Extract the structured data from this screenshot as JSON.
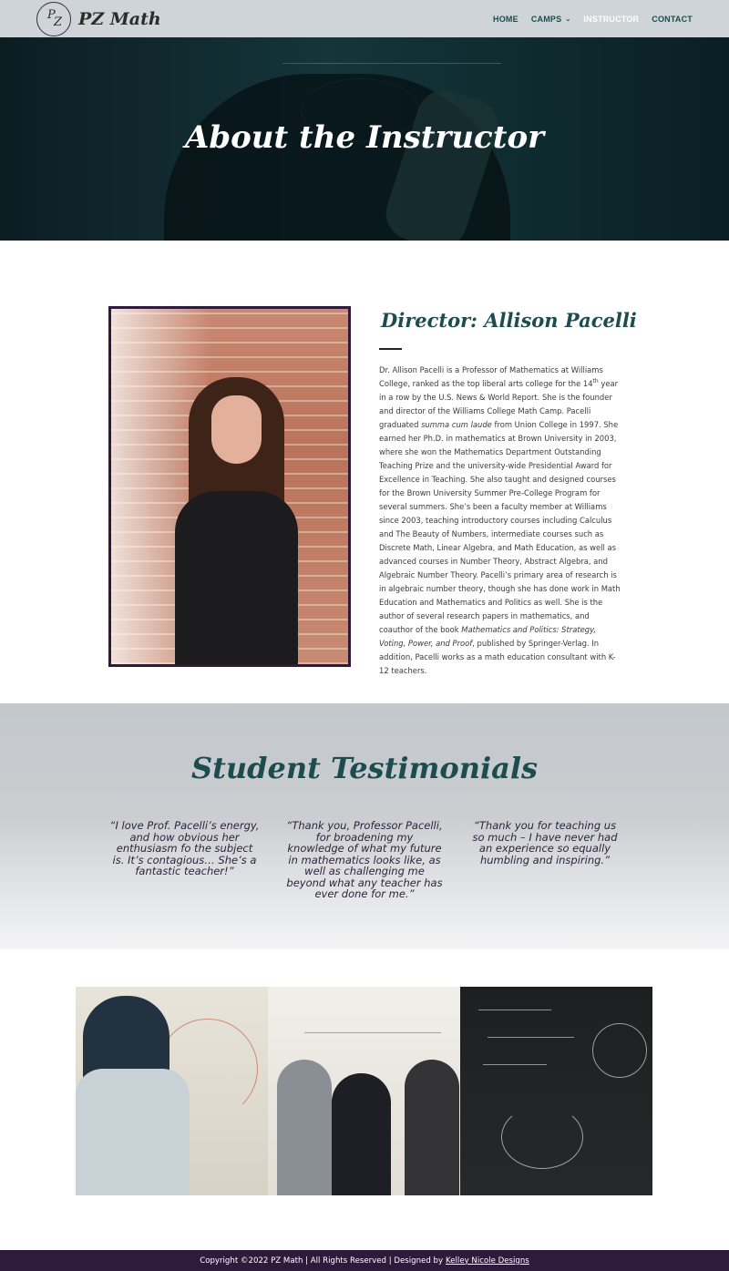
{
  "header": {
    "logo_text": "PZ Math",
    "logo_mark": {
      "p": "P",
      "z": "Z"
    },
    "nav": [
      {
        "label": "HOME",
        "active": false
      },
      {
        "label": "CAMPS",
        "active": false,
        "has_dropdown": true
      },
      {
        "label": "INSTRUCTOR",
        "active": true
      },
      {
        "label": "CONTACT",
        "active": false
      }
    ]
  },
  "hero": {
    "title": "About the Instructor"
  },
  "about": {
    "heading": "Director: Allison Pacelli",
    "bio": {
      "p1": "Dr. Allison Pacelli is a Professor of Mathematics at Williams College, ranked as the top liberal arts college for the 14",
      "p1_sup": "th",
      "p2": " year in a row by the U.S. News & World Report. She is the founder and director of the Williams College Math Camp. Pacelli graduated ",
      "p2_em": "summa cum laude",
      "p3": " from Union College in 1997. She earned her Ph.D. in mathematics at Brown University in 2003, where she won the Mathematics Department Outstanding Teaching Prize and the university-wide Presidential Award for Excellence in Teaching. She also taught and designed courses for the Brown University Summer Pre-College Program for several summers. She’s been a faculty member at Williams since 2003, teaching introductory courses including Calculus and The Beauty of Numbers, intermediate courses such as Discrete Math, Linear Algebra, and Math Education, as well as advanced courses in Number Theory, Abstract Algebra, and Algebraic Number Theory. Pacelli’s primary area of research is in algebraic number theory, though she has done work in Math Education and Mathematics and Politics as well. She is the author of several research papers in mathematics, and coauthor of the book ",
      "p3_em": "Mathematics and Politics: Strategy, Voting, Power, and Proof",
      "p4": ", published by Springer-Verlag. In addition, Pacelli works as a math education consultant with K-12 teachers."
    }
  },
  "testimonials": {
    "heading": "Student Testimonials",
    "quotes": [
      "“I love Prof. Pacelli’s energy, and how obvious her enthusiasm fo the subject is. It’s contagious… She’s a fantastic teacher!”",
      "“Thank you, Professor Pacelli, for broadening my knowledge of what my future in mathematics looks like, as well as challenging me beyond what any teacher has ever done for me.”",
      "“Thank you for teaching us so much – I have never had an experience so equally humbling and inspiring.”"
    ]
  },
  "footer": {
    "text": "Copyright ©2022 PZ Math | All Rights Reserved | Designed by",
    "link": "Kelley Nicole Designs"
  },
  "colors": {
    "header_bg": "#ced4d8",
    "teal": "#1d4c4f",
    "purple": "#2e1a3b",
    "white": "#ffffff"
  }
}
